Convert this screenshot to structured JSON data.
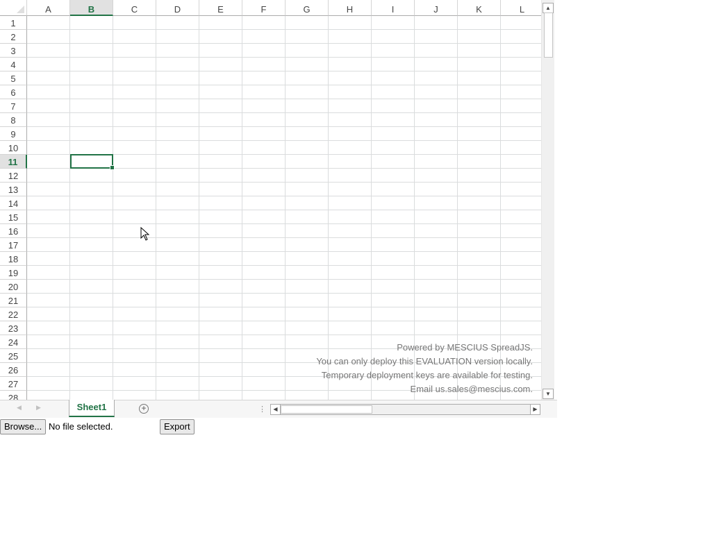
{
  "spreadsheet": {
    "columns": [
      "A",
      "B",
      "C",
      "D",
      "E",
      "F",
      "G",
      "H",
      "I",
      "J",
      "K",
      "L"
    ],
    "rows": [
      "1",
      "2",
      "3",
      "4",
      "5",
      "6",
      "7",
      "8",
      "9",
      "10",
      "11",
      "12",
      "13",
      "14",
      "15",
      "16",
      "17",
      "18",
      "19",
      "20",
      "21",
      "22",
      "23",
      "24",
      "25",
      "26",
      "27",
      "28"
    ],
    "active_column": "B",
    "active_row": "11",
    "selected_cell": "B11",
    "accent_color": "#217346"
  },
  "watermark": {
    "lines": [
      "Powered by MESCIUS SpreadJS.",
      "You can only deploy this EVALUATION version locally.",
      "Temporary deployment keys are available for testing.",
      "Email us.sales@mescius.com."
    ]
  },
  "tabs": {
    "sheets": [
      "Sheet1"
    ],
    "active_sheet": "Sheet1",
    "add_icon": "plus-circle-icon"
  },
  "controls": {
    "browse_label": "Browse...",
    "file_status": "No file selected.",
    "export_label": "Export"
  }
}
